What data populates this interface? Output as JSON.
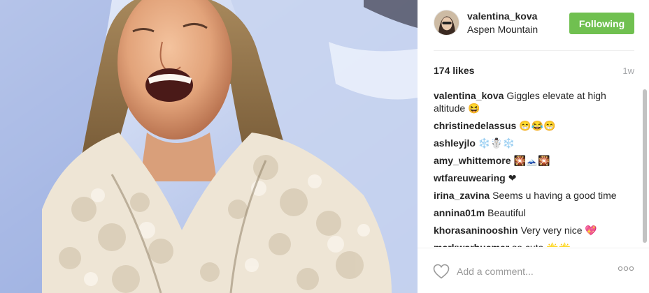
{
  "post": {
    "image_alt": "Woman laughing in a fur coat on a snowy road",
    "author": {
      "username": "valentina_kova",
      "location": "Aspen Mountain"
    },
    "follow_button": {
      "label": "Following",
      "color": "#70c050"
    },
    "likes": "174 likes",
    "time_ago": "1w",
    "comments": [
      {
        "author": "valentina_kova",
        "text": "Giggles elevate at high altitude 😆"
      },
      {
        "author": "christinedelassus",
        "text": "😁😂😁"
      },
      {
        "author": "ashleyjlo",
        "text": "❄️☃️❄️"
      },
      {
        "author": "amy_whittemore",
        "text": "🎇🗻🎇"
      },
      {
        "author": "wtfareuwearing",
        "text": "❤"
      },
      {
        "author": "irina_zavina",
        "text": "Seems u having a good time"
      },
      {
        "author": "annina01m",
        "text": "Beautiful"
      },
      {
        "author": "khorasaninooshin",
        "text": "Very very nice 💖"
      },
      {
        "author": "markwarhuemer",
        "text": "so cute 🌟🌟"
      }
    ],
    "add_comment_placeholder": "Add a comment...",
    "icons": {
      "like": "heart-icon",
      "more": "more-options-icon"
    }
  }
}
